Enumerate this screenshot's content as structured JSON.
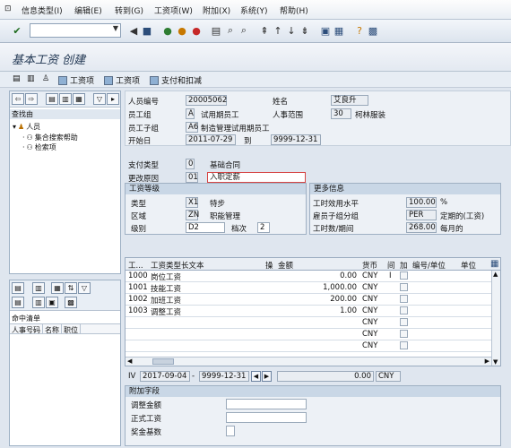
{
  "menubar": {
    "items": [
      "信息类型(I)",
      "编辑(E)",
      "转到(G)",
      "工资项(W)",
      "附加(X)",
      "系统(Y)",
      "帮助(H)"
    ]
  },
  "toolbar": {
    "command_value": ""
  },
  "title": "基本工资 创建",
  "app_toolbar": {
    "btn1": "工资项",
    "btn2": "工资项",
    "btn3": "支付和扣减"
  },
  "left_panel": {
    "header": "查找由",
    "tree": [
      {
        "label": "人员"
      },
      {
        "label": "集合搜索帮助"
      },
      {
        "label": "检索项"
      }
    ],
    "hit_list_label": "命中清单",
    "hit_columns": [
      "人事号码",
      "名称",
      "职位"
    ]
  },
  "header": {
    "personnel_no_label": "人员编号",
    "personnel_no": "20005062",
    "name_label": "姓名",
    "name": "艾良升",
    "emp_group_label": "员工组",
    "emp_group_code": "A",
    "emp_group_text": "试用期员工",
    "pers_area_label": "人事范围",
    "pers_area_code": "30",
    "pers_area_text": "柯林服装",
    "emp_subgroup_label": "员工子组",
    "emp_subgroup_code": "A6",
    "emp_subgroup_text": "制造管理试用期员工",
    "start_label": "开始日",
    "start": "2011-07-29",
    "to_label": "到",
    "end": "9999-12-31"
  },
  "pay": {
    "pay_type_label": "支付类型",
    "pay_type_code": "0",
    "pay_type_text": "基础合同",
    "reason_label": "更改原因",
    "reason_code": "01",
    "reason_text": "入职定薪"
  },
  "grade": {
    "title": "工资等级",
    "type_label": "类型",
    "type_code": "X1",
    "type_text": "特步",
    "area_label": "区域",
    "area_code": "ZN",
    "area_text": "职能管理",
    "level_label": "级别",
    "level": "D2",
    "step_label": "档次",
    "step": "2"
  },
  "more": {
    "title": "更多信息",
    "capacity_label": "工时效用水平",
    "capacity": "100.00",
    "capacity_unit": "%",
    "ee_sub_label": "雇员子组分组",
    "ee_sub": "PER",
    "ee_sub_text": "定期的(工资)",
    "hours_label": "工时数/期间",
    "hours": "268.00",
    "hours_unit": "每月的"
  },
  "table": {
    "columns": [
      "工...",
      "工资类型长文本",
      "操",
      "金额",
      "货币",
      "间",
      "加",
      "编号/单位",
      "单位"
    ],
    "rows": [
      {
        "code": "1000",
        "text": "岗位工资",
        "amount": "0.00",
        "currency": "CNY",
        "ind": "I"
      },
      {
        "code": "1001",
        "text": "技能工资",
        "amount": "1,000.00",
        "currency": "CNY",
        "ind": ""
      },
      {
        "code": "1002",
        "text": "加班工资",
        "amount": "200.00",
        "currency": "CNY",
        "ind": ""
      },
      {
        "code": "1003",
        "text": "调整工资",
        "amount": "1.00",
        "currency": "CNY",
        "ind": ""
      },
      {
        "code": "",
        "text": "",
        "amount": "",
        "currency": "CNY",
        "ind": ""
      },
      {
        "code": "",
        "text": "",
        "amount": "",
        "currency": "CNY",
        "ind": ""
      },
      {
        "code": "",
        "text": "",
        "amount": "",
        "currency": "CNY",
        "ind": ""
      }
    ]
  },
  "summary": {
    "label": "IV",
    "from": "2017-09-04",
    "dash": "-",
    "to": "9999-12-31",
    "total": "0.00",
    "currency": "CNY"
  },
  "additional": {
    "title": "附加字段",
    "adj_label": "调整金额",
    "adj": "",
    "regular_label": "正式工资",
    "regular": "",
    "bonus_label": "奖金基数",
    "bonus": ""
  }
}
